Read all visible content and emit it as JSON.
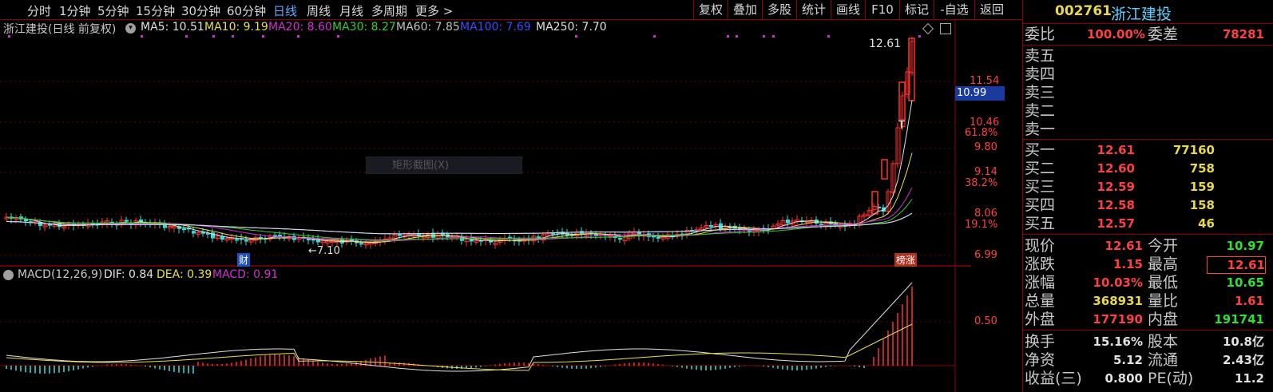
{
  "timeframes": [
    "分时",
    "1分钟",
    "5分钟",
    "15分钟",
    "30分钟",
    "60分钟",
    "日线",
    "周线",
    "月线",
    "多周期",
    "更多 >"
  ],
  "toolbar": [
    "复权",
    "叠加",
    "多股",
    "统计",
    "画线",
    "F10",
    "标记",
    "-自选",
    "返回"
  ],
  "header": {
    "code": "002761",
    "name": "浙江建投"
  },
  "legend": {
    "title": "浙江建投(日线 前复权)",
    "ma": [
      {
        "label": "MA5: 10.51",
        "color": "#e0e0e0"
      },
      {
        "label": "MA10: 9.19",
        "color": "#e8e04a"
      },
      {
        "label": "MA20: 8.60",
        "color": "#d030d0"
      },
      {
        "label": "MA30: 8.27",
        "color": "#30d030"
      },
      {
        "label": "MA60: 7.85",
        "color": "#c0c0c0"
      },
      {
        "label": "MA100: 7.69",
        "color": "#3050ff"
      },
      {
        "label": "MA250: 7.70",
        "color": "#e0e0e0"
      }
    ]
  },
  "macd": {
    "name": "MACD(12,26,9)",
    "dif": "DIF: 0.84",
    "dea": "DEA: 0.39",
    "macd": "MACD: 0.91",
    "axis": "0.50"
  },
  "price_axis": [
    "11.54",
    "10.46",
    "9.80",
    "9.14",
    "8.06",
    "6.99"
  ],
  "pct_axis": [
    "61.8%",
    "38.2%",
    "19.1%"
  ],
  "crosshair_price": "10.99",
  "annotations": {
    "high": "12.61",
    "low": "←7.10",
    "cai": "财",
    "bang": "榜涨",
    "tmark": "T",
    "context_menu": "矩形截图(X)"
  },
  "colors": {
    "up": "#ff3030",
    "down": "#30e0e0",
    "grid": "#8b0000",
    "accent": "#5fa8ff"
  },
  "orderbook": {
    "weibi": {
      "label": "委比",
      "value": "100.00%",
      "label2": "委差",
      "value2": "78281"
    },
    "sell": [
      {
        "label": "卖五"
      },
      {
        "label": "卖四"
      },
      {
        "label": "卖三"
      },
      {
        "label": "卖二"
      },
      {
        "label": "卖一"
      }
    ],
    "buy": [
      {
        "label": "买一",
        "price": "12.61",
        "vol": "77160"
      },
      {
        "label": "买二",
        "price": "12.60",
        "vol": "758"
      },
      {
        "label": "买三",
        "price": "12.59",
        "vol": "159"
      },
      {
        "label": "买四",
        "price": "12.58",
        "vol": "158"
      },
      {
        "label": "买五",
        "price": "12.57",
        "vol": "46"
      }
    ]
  },
  "quote": [
    {
      "l1": "现价",
      "v1": "12.61",
      "c1": "red",
      "l2": "今开",
      "v2": "10.97",
      "c2": "grn"
    },
    {
      "l1": "涨跌",
      "v1": "1.15",
      "c1": "red",
      "l2": "最高",
      "v2": "12.61",
      "c2": "red"
    },
    {
      "l1": "涨幅",
      "v1": "10.03%",
      "c1": "red",
      "l2": "最低",
      "v2": "10.65",
      "c2": "grn"
    },
    {
      "l1": "总量",
      "v1": "368931",
      "c1": "yel",
      "l2": "量比",
      "v2": "1.61",
      "c2": "red"
    },
    {
      "l1": "外盘",
      "v1": "177190",
      "c1": "red",
      "l2": "内盘",
      "v2": "191741",
      "c2": "grn"
    }
  ],
  "stats": [
    {
      "l1": "换手",
      "v1": "15.16%",
      "l2": "股本",
      "v2": "10.8亿"
    },
    {
      "l1": "净资",
      "v1": "5.12",
      "l2": "流通",
      "v2": "2.43亿"
    },
    {
      "l1": "收益(三)",
      "v1": "0.800",
      "l2": "PE(动)",
      "v2": "11.2"
    }
  ]
}
